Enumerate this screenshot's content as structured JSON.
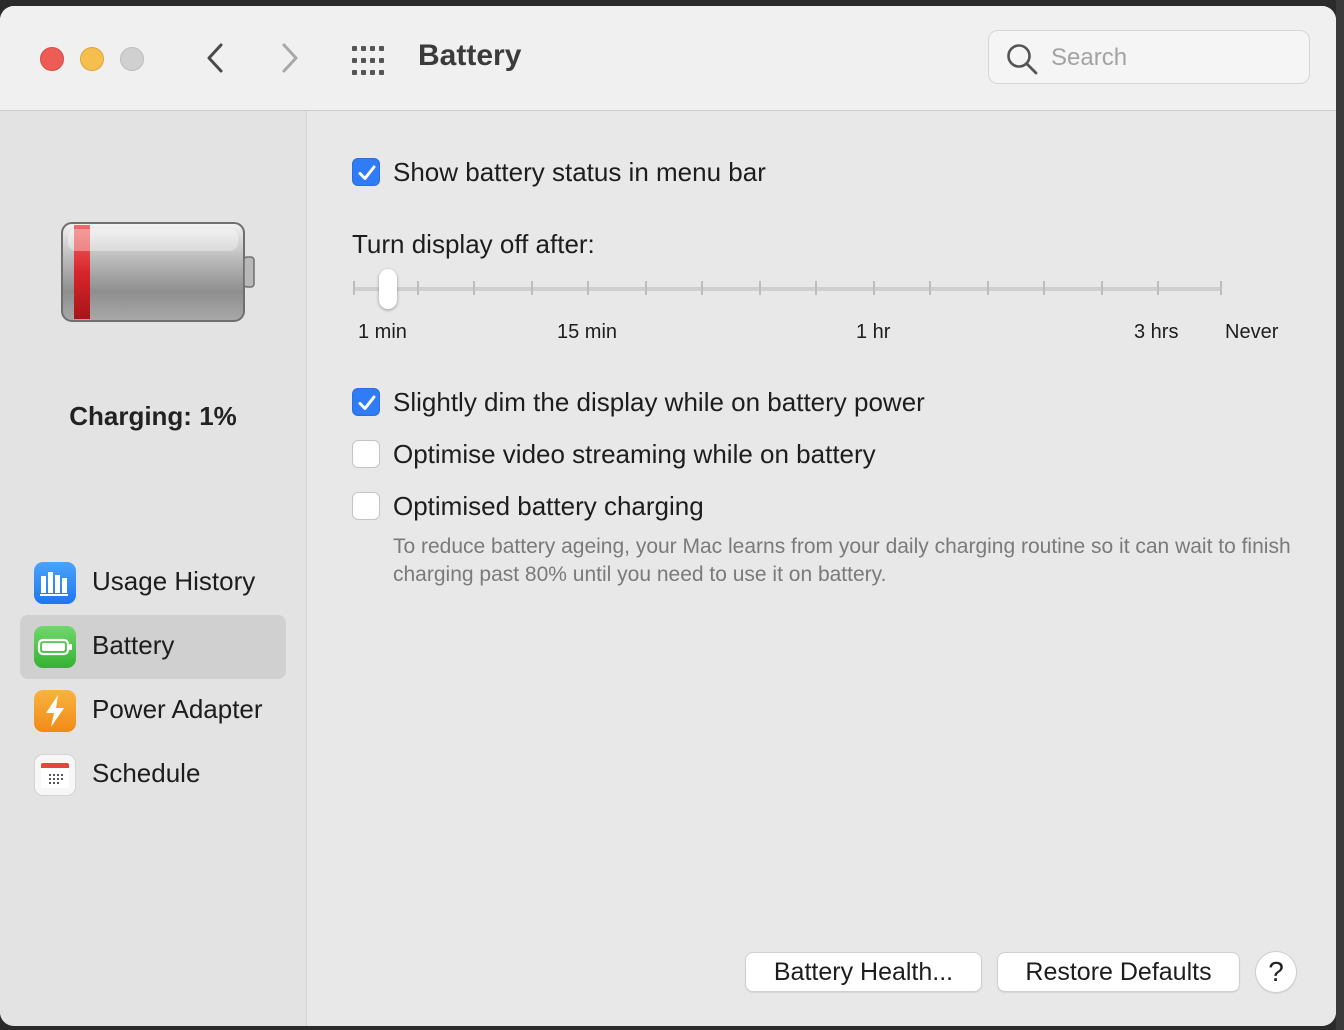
{
  "window": {
    "title": "Battery",
    "search_placeholder": "Search"
  },
  "sidebar": {
    "status": "Charging: 1%",
    "items": [
      {
        "label": "Usage History",
        "icon": "bar-chart-icon"
      },
      {
        "label": "Battery",
        "icon": "battery-icon",
        "selected": true
      },
      {
        "label": "Power Adapter",
        "icon": "lightning-icon"
      },
      {
        "label": "Schedule",
        "icon": "calendar-icon"
      }
    ]
  },
  "main": {
    "show_status": {
      "label": "Show battery status in menu bar",
      "checked": true
    },
    "display_off": {
      "title": "Turn display off after:",
      "tick_labels": [
        "1 min",
        "15 min",
        "1 hr",
        "3 hrs",
        "Never"
      ],
      "value": "1 min"
    },
    "dim_display": {
      "label": "Slightly dim the display while on battery power",
      "checked": true
    },
    "video_streaming": {
      "label": "Optimise video streaming while on battery",
      "checked": false
    },
    "optimised_charging": {
      "label": "Optimised battery charging",
      "checked": false,
      "description": "To reduce battery ageing, your Mac learns from your daily charging routine so it can wait to finish charging past 80% until you need to use it on battery."
    }
  },
  "footer": {
    "battery_health": "Battery Health...",
    "restore_defaults": "Restore Defaults",
    "help": "?"
  },
  "colors": {
    "accent": "#2f7cf6",
    "battery_low": "#d8262b",
    "usage_icon": "#2e8cf5",
    "battery_icon": "#4cc94a",
    "power_icon": "#f59a22"
  }
}
